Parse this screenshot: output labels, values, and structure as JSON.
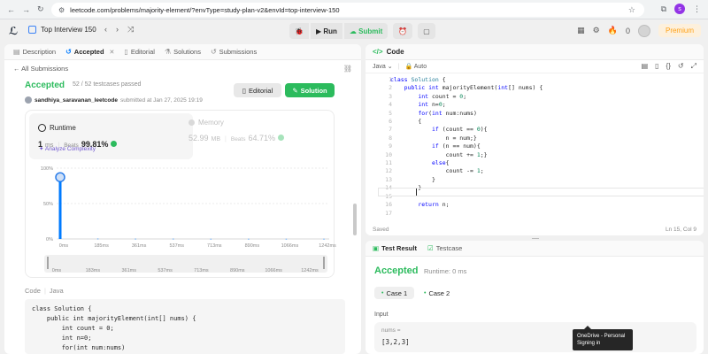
{
  "browser": {
    "url": "leetcode.com/problems/majority-element/?envType=study-plan-v2&envId=top-interview-150",
    "profile_letter": "s"
  },
  "topbar": {
    "problem_list": "Top Interview 150",
    "run_label": "Run",
    "submit_label": "Submit",
    "notif_count": "0",
    "premium_label": "Premium"
  },
  "left_tabs": [
    {
      "label": "Description"
    },
    {
      "label": "Accepted"
    },
    {
      "label": "Editorial"
    },
    {
      "label": "Solutions"
    },
    {
      "label": "Submissions"
    }
  ],
  "back_link": "All Submissions",
  "submission": {
    "status": "Accepted",
    "testcases": "52 / 52 testcases passed",
    "username": "sandhiya_saravanan_leetcode",
    "submitted": "submitted at Jan 27, 2025 19:19",
    "editorial_btn": "Editorial",
    "solution_btn": "Solution"
  },
  "runtime": {
    "title": "Runtime",
    "value": "1",
    "unit": "ms",
    "beats_label": "Beats",
    "beats": "99.81%",
    "analyze": "Analyze Complexity"
  },
  "memory": {
    "title": "Memory",
    "value": "52.99",
    "unit": "MB",
    "beats_label": "Beats",
    "beats": "64.71%"
  },
  "chart_data": {
    "type": "bar",
    "y_ticks": [
      "100%",
      "50%",
      "0%"
    ],
    "categories": [
      "0ms",
      "185ms",
      "361ms",
      "537ms",
      "713ms",
      "890ms",
      "1066ms",
      "1242ms"
    ],
    "slider_ticks": [
      "0ms",
      "183ms",
      "361ms",
      "537ms",
      "713ms",
      "890ms",
      "1066ms",
      "1242ms"
    ],
    "values": [
      91,
      0.4,
      0.3,
      0.3,
      0.2,
      0.2,
      0.2,
      0.2
    ],
    "ylim": [
      0,
      100
    ],
    "colors": {
      "bar": "#007bff",
      "highlight": "#2b7de9"
    }
  },
  "code_label": {
    "title": "Code",
    "lang": "Java"
  },
  "code_preview": [
    "class Solution {",
    "    public int majorityElement(int[] nums) {",
    "        int count = 0;",
    "        int n=0;",
    "        for(int num:nums)"
  ],
  "editor": {
    "title": "Code",
    "language": "Java",
    "mode": "Auto",
    "saved": "Saved",
    "position": "Ln 15, Col 9",
    "line_numbers": [
      "1",
      "2",
      "3",
      "4",
      "5",
      "6",
      "7",
      "8",
      "9",
      "10",
      "11",
      "12",
      "13",
      "14",
      "15",
      "16",
      "17"
    ]
  },
  "test_tabs": {
    "result": "Test Result",
    "testcase": "Testcase"
  },
  "test_result": {
    "status": "Accepted",
    "runtime": "Runtime: 0 ms",
    "case1": "Case 1",
    "case2": "Case 2",
    "input_label": "Input",
    "var_name": "nums =",
    "var_value": "[3,2,3]"
  },
  "toast": {
    "line1": "OneDrive - Personal",
    "line2": "Signing in"
  }
}
